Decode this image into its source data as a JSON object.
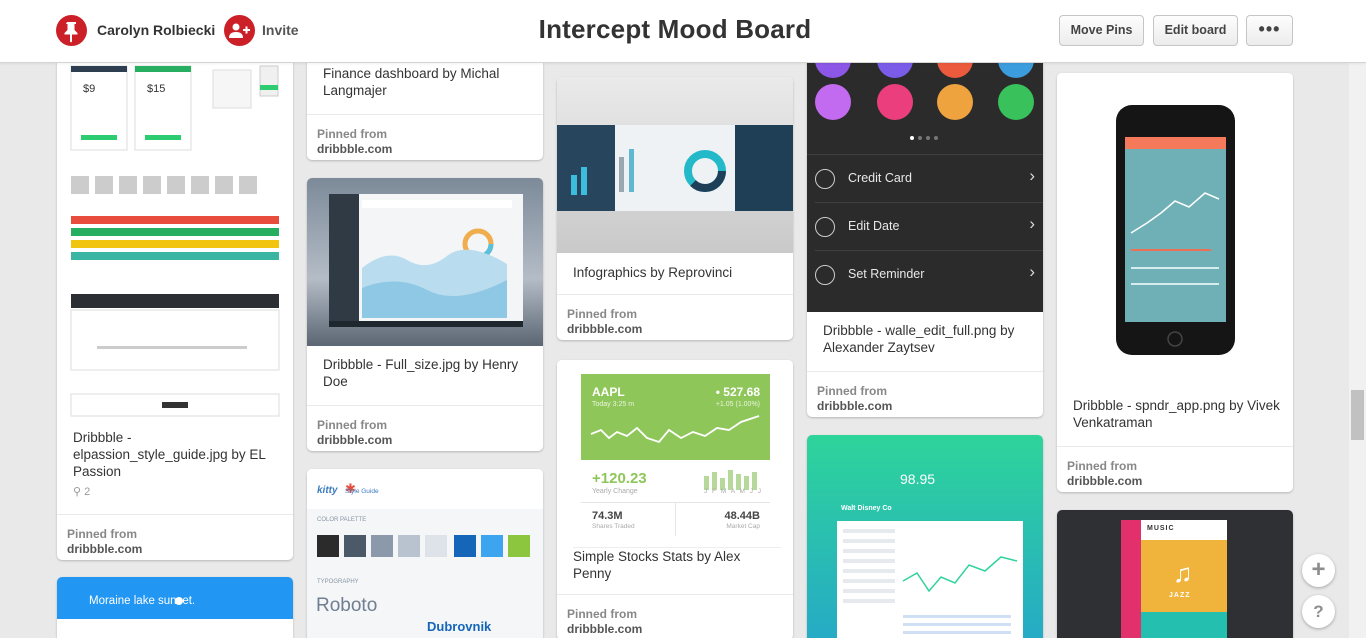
{
  "header": {
    "owner_name": "Carolyn Rolbiecki",
    "invite_label": "Invite",
    "board_title": "Intercept Mood Board",
    "move_pins_label": "Move Pins",
    "edit_board_label": "Edit board",
    "more_label": "•••"
  },
  "pins": {
    "elpassion": {
      "description": "Dribbble - elpassion_style_guide.jpg by EL Passion",
      "repins": "2",
      "pinned_from": "Pinned from",
      "source": "dribbble.com"
    },
    "finance": {
      "description": "Finance dashboard by Michal Langmajer",
      "pinned_from": "Pinned from",
      "source": "dribbble.com"
    },
    "full_size": {
      "description": "Dribbble - Full_size.jpg by Henry Doe",
      "pinned_from": "Pinned from",
      "source": "dribbble.com"
    },
    "kitty": {
      "logo": "kitty",
      "subtitle": "Style Guide",
      "palette_label": "COLOR PALETTE",
      "typography_label": "TYPOGRAPHY",
      "font_sample": "Roboto",
      "font_sample_2": "Dubrovnik"
    },
    "infographics": {
      "description": "Infographics by Reprovinci",
      "pinned_from": "Pinned from",
      "source": "dribbble.com"
    },
    "stocks": {
      "ticker": "AAPL",
      "price": "• 527.68",
      "time": "Today 3:25 m",
      "change_small": "+1.05 (1.00%)",
      "yearly_value": "+120.23",
      "yearly_label": "Yearly Change",
      "months": "J F M A M J J",
      "shares_value": "74.3M",
      "shares_label": "Shares Traded",
      "cap_value": "48.44B",
      "cap_label": "Market Cap",
      "description": "Simple Stocks Stats by Alex Penny",
      "pinned_from": "Pinned from",
      "source": "dribbble.com"
    },
    "walle": {
      "menu": [
        "Credit Card",
        "Edit Date",
        "Set Reminder"
      ],
      "description": "Dribbble - walle_edit_full.png by Alexander Zaytsev",
      "pinned_from": "Pinned from",
      "source": "dribbble.com"
    },
    "disney": {
      "price": "98.95",
      "company": "Walt Disney Co"
    },
    "spndr": {
      "description": "Dribbble - spndr_app.png by Vivek Venkatraman",
      "pinned_from": "Pinned from",
      "source": "dribbble.com"
    },
    "music": {
      "title": "MUSIC",
      "genre": "JAZZ"
    },
    "moraine": {
      "title": "Moraine lake sunset."
    }
  },
  "colors": {
    "brand_red": "#cb2027",
    "stocks_green": "#8fc65a",
    "disney_teal": "#2ed49a",
    "music_yellow": "#f0b43c",
    "music_pink": "#e2306c"
  },
  "icons": [
    "pinterest-icon",
    "add-person-icon",
    "plus-icon",
    "question-icon",
    "chevron-right-icon",
    "credit-card-icon",
    "calendar-icon",
    "bell-icon"
  ]
}
